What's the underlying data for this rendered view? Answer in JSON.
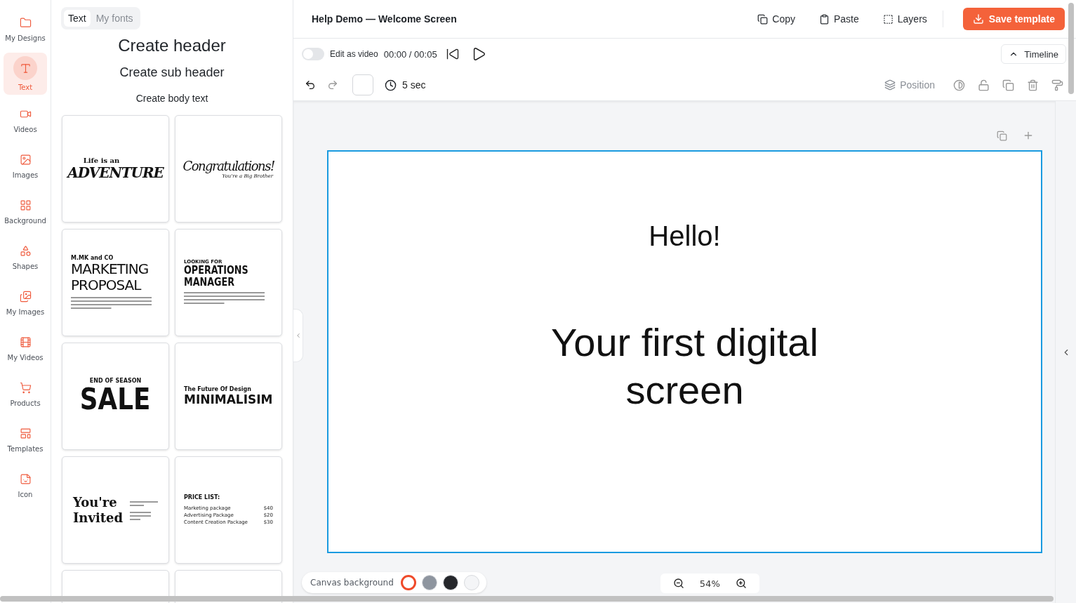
{
  "sidebar": {
    "items": [
      {
        "label": "My Designs",
        "selected": false
      },
      {
        "label": "Text",
        "selected": true
      },
      {
        "label": "Videos",
        "selected": false
      },
      {
        "label": "Images",
        "selected": false
      },
      {
        "label": "Background",
        "selected": false
      },
      {
        "label": "Shapes",
        "selected": false
      },
      {
        "label": "My Images",
        "selected": false
      },
      {
        "label": "My Videos",
        "selected": false
      },
      {
        "label": "Products",
        "selected": false
      },
      {
        "label": "Templates",
        "selected": false
      },
      {
        "label": "Icon",
        "selected": false
      }
    ]
  },
  "panel": {
    "tabs": [
      {
        "label": "Text",
        "selected": true
      },
      {
        "label": "My fonts",
        "selected": false
      }
    ],
    "header": "Create header",
    "sub_header": "Create sub header",
    "body_text": "Create body text",
    "templates": [
      {
        "kind": "centered",
        "lines": [
          "Life is an",
          "ADVENTURE"
        ]
      },
      {
        "kind": "centered",
        "lines": [
          "Congratulations!",
          "You're a Big Brother"
        ]
      },
      {
        "kind": "left",
        "lines": [
          "M.MK and CO",
          "MARKETING",
          "PROPOSAL"
        ]
      },
      {
        "kind": "left",
        "lines": [
          "LOOKING FOR",
          "OPERATIONS",
          "MANAGER"
        ]
      },
      {
        "kind": "centered",
        "lines": [
          "END OF SEASON",
          "SALE"
        ]
      },
      {
        "kind": "left",
        "lines": [
          "The Future Of Design",
          "MINIMALISIM"
        ]
      },
      {
        "kind": "invite",
        "lines": [
          "You're",
          "Invited"
        ]
      },
      {
        "kind": "price",
        "title": "PRICE LIST:",
        "rows": [
          {
            "item": "Marketing package",
            "price": "$40"
          },
          {
            "item": "Advertising Package",
            "price": "$20"
          },
          {
            "item": "Content Creation Package",
            "price": "$30"
          }
        ]
      },
      {
        "kind": "blank"
      },
      {
        "kind": "blank"
      }
    ]
  },
  "topbar": {
    "title": "Help Demo — Welcome Screen",
    "actions": [
      {
        "label": "Copy"
      },
      {
        "label": "Paste"
      },
      {
        "label": "Layers"
      }
    ],
    "save": "Save template"
  },
  "video_bar": {
    "edit_as_video": {
      "label": "Edit as video",
      "on": false
    },
    "time": "00:00 / 00:05",
    "timeline": "Timeline"
  },
  "edit_bar": {
    "duration": "5 sec",
    "position": "Position"
  },
  "canvas": {
    "texts": [
      {
        "text": "Hello!",
        "kind": "heading"
      },
      {
        "text": "Your first digital screen",
        "kind": "title"
      }
    ]
  },
  "canvas_background": {
    "label": "Canvas background",
    "swatches": [
      {
        "color": "#ffffff",
        "selected": true
      },
      {
        "color": "#8e959f",
        "selected": false
      },
      {
        "color": "#25272b",
        "selected": false
      },
      {
        "color": "#f4f5f7",
        "selected": false
      }
    ]
  },
  "zoom": {
    "value": "54%"
  }
}
